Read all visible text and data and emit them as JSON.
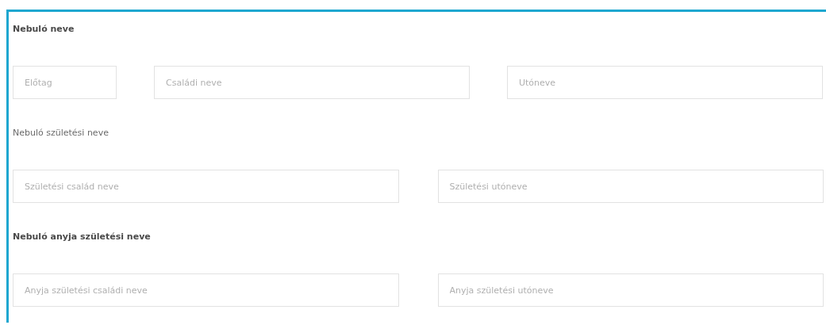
{
  "sections": [
    {
      "heading": "Nebuló neve",
      "bold": true,
      "fields": [
        {
          "placeholder": "Előtag"
        },
        {
          "placeholder": "Családi neve"
        },
        {
          "placeholder": "Utóneve"
        }
      ]
    },
    {
      "heading": "Nebuló születési neve",
      "bold": false,
      "fields": [
        {
          "placeholder": "Születési család neve"
        },
        {
          "placeholder": "Születési utóneve"
        }
      ]
    },
    {
      "heading": "Nebuló anyja születési neve",
      "bold": true,
      "fields": [
        {
          "placeholder": "Anyja születési családi neve"
        },
        {
          "placeholder": "Anyja születési utóneve"
        }
      ]
    }
  ]
}
